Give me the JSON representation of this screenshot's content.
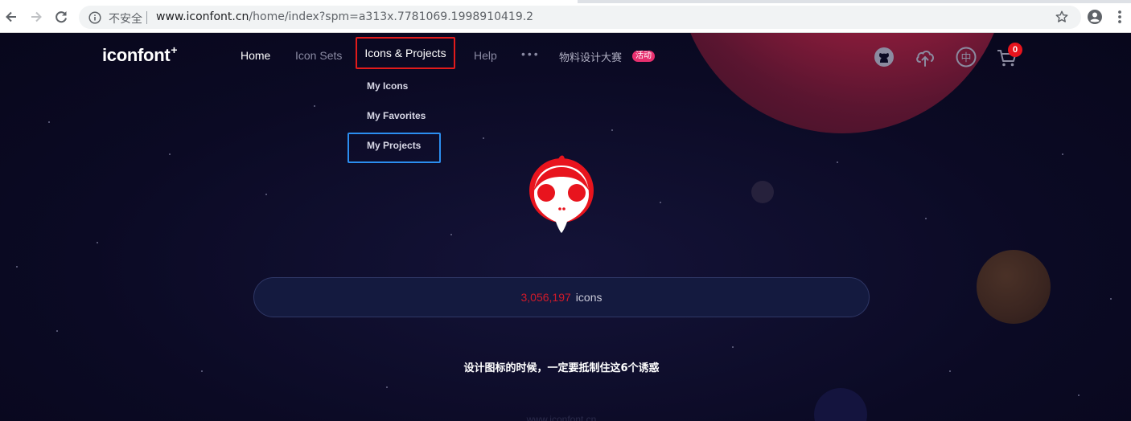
{
  "browser": {
    "security_label": "不安全",
    "url_domain": "www.iconfont.cn",
    "url_path": "/home/index?spm=a313x.7781069.1998910419.2"
  },
  "header": {
    "logo": "iconfont",
    "logo_mark": "+",
    "nav": {
      "home": "Home",
      "icon_sets": "Icon Sets",
      "icons_projects": "Icons & Projects",
      "help": "Help",
      "more": "•••",
      "contest": "物料设计大赛",
      "contest_badge": "活动"
    },
    "dropdown": {
      "my_icons": "My Icons",
      "my_favorites": "My Favorites",
      "my_projects": "My Projects"
    },
    "icons": [
      "github-icon",
      "upload-icon",
      "language-zh-icon",
      "cart-icon"
    ],
    "language_glyph": "中",
    "cart_count": "0"
  },
  "search": {
    "count": "3,056,197",
    "unit": "icons"
  },
  "tagline": "设计图标的时候，一定要抵制住这6个诱惑",
  "footer_text": "www.iconfont.cn",
  "colors": {
    "background": "#0b0a24",
    "accent_red": "#e21b1b",
    "highlight_blue": "#2b8ef0",
    "count_red": "#d11a2a",
    "badge_pink": "#e7306f"
  }
}
